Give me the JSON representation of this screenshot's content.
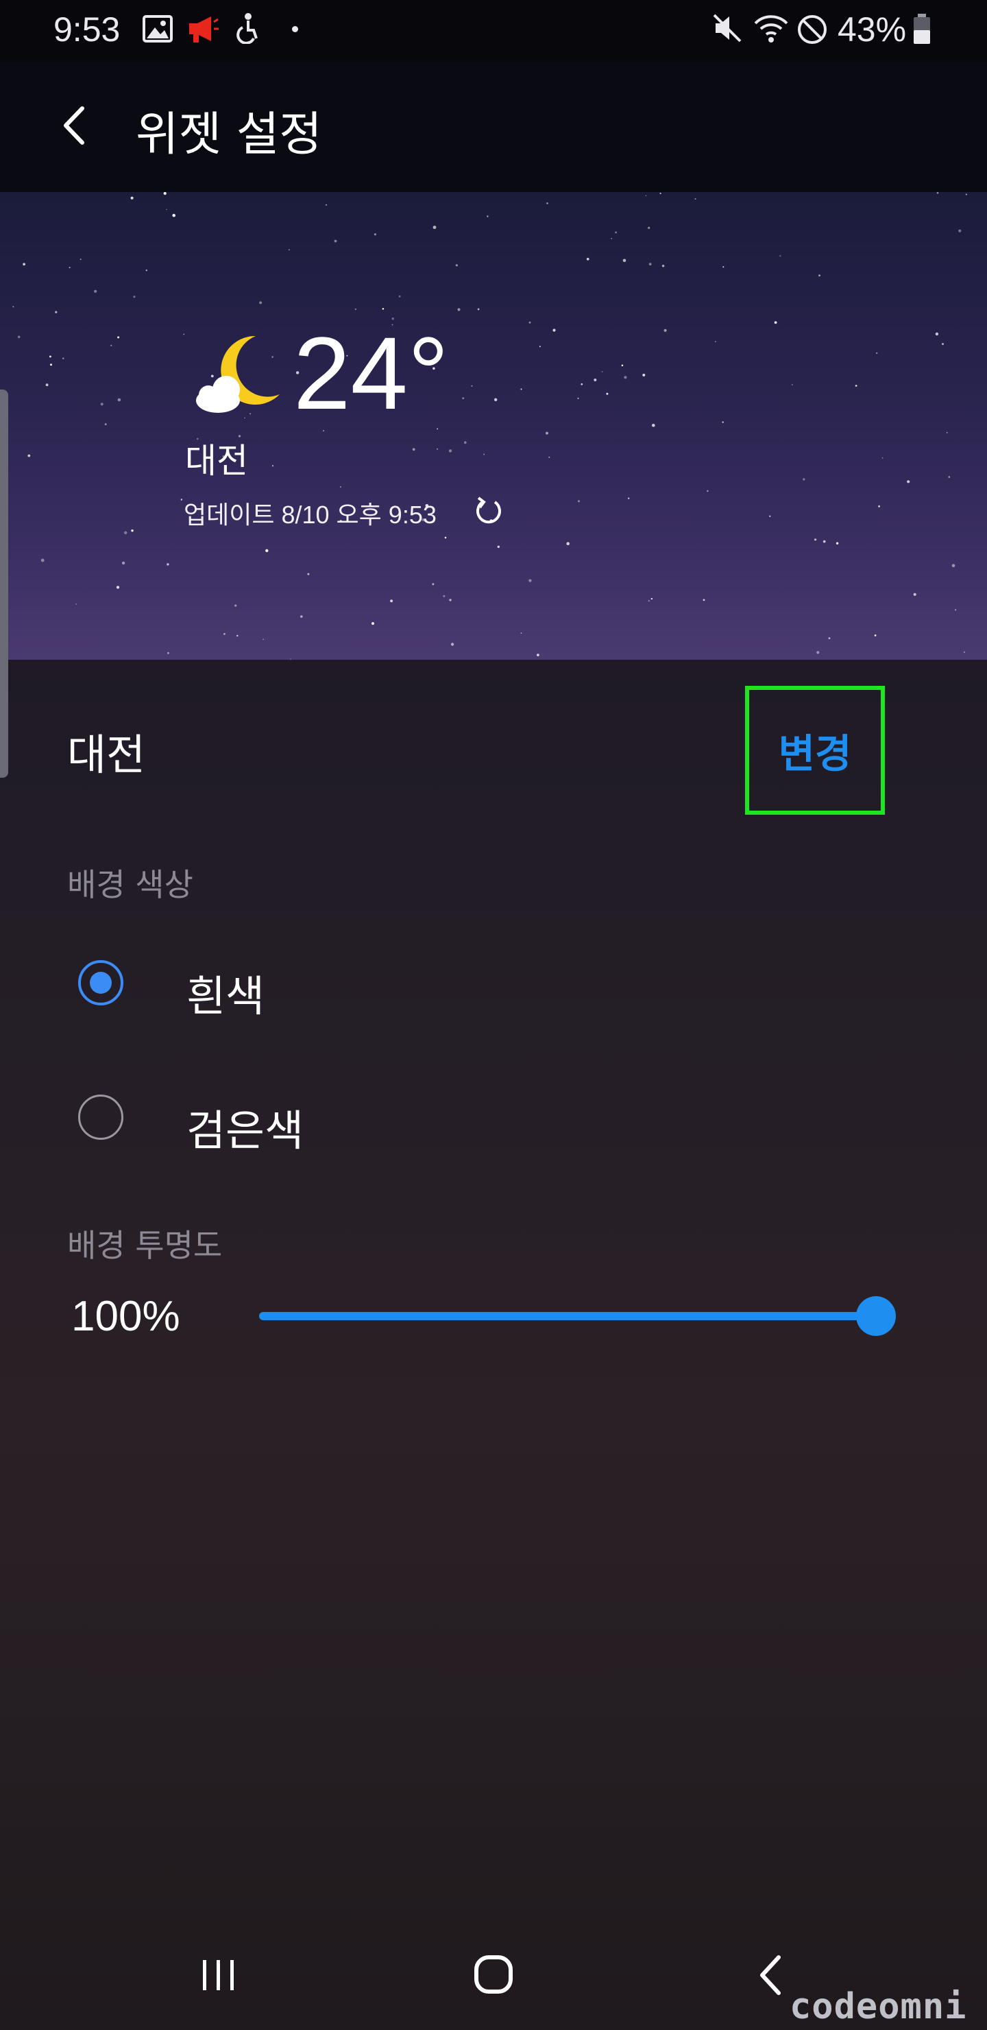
{
  "status_bar": {
    "time": "9:53",
    "battery_percent": "43%",
    "icons": [
      "gallery-icon",
      "megaphone-icon",
      "accessibility-icon",
      "dot-icon",
      "mute-icon",
      "wifi-icon",
      "do-not-disturb-icon",
      "battery-icon"
    ]
  },
  "header": {
    "title": "위젯 설정",
    "back_icon": "back-arrow-icon"
  },
  "preview": {
    "weather_icon": "moon-cloud-icon",
    "temperature": "24°",
    "city": "대전",
    "update_text": "업데이트 8/10 오후 9:53",
    "refresh_icon": "refresh-icon"
  },
  "location": {
    "name": "대전",
    "change_label": "변경"
  },
  "background_color": {
    "label": "배경 색상",
    "options": [
      {
        "label": "흰색",
        "checked": true
      },
      {
        "label": "검은색",
        "checked": false
      }
    ]
  },
  "background_opacity": {
    "label": "배경 투명도",
    "value_text": "100%",
    "value": 1.0
  },
  "nav": {
    "recents_icon": "recents-icon",
    "home_icon": "home-icon",
    "back_icon": "back-icon"
  },
  "watermark": "codeomni",
  "colors": {
    "accent": "#1e8ef0",
    "highlight_box": "#1ee61e"
  }
}
